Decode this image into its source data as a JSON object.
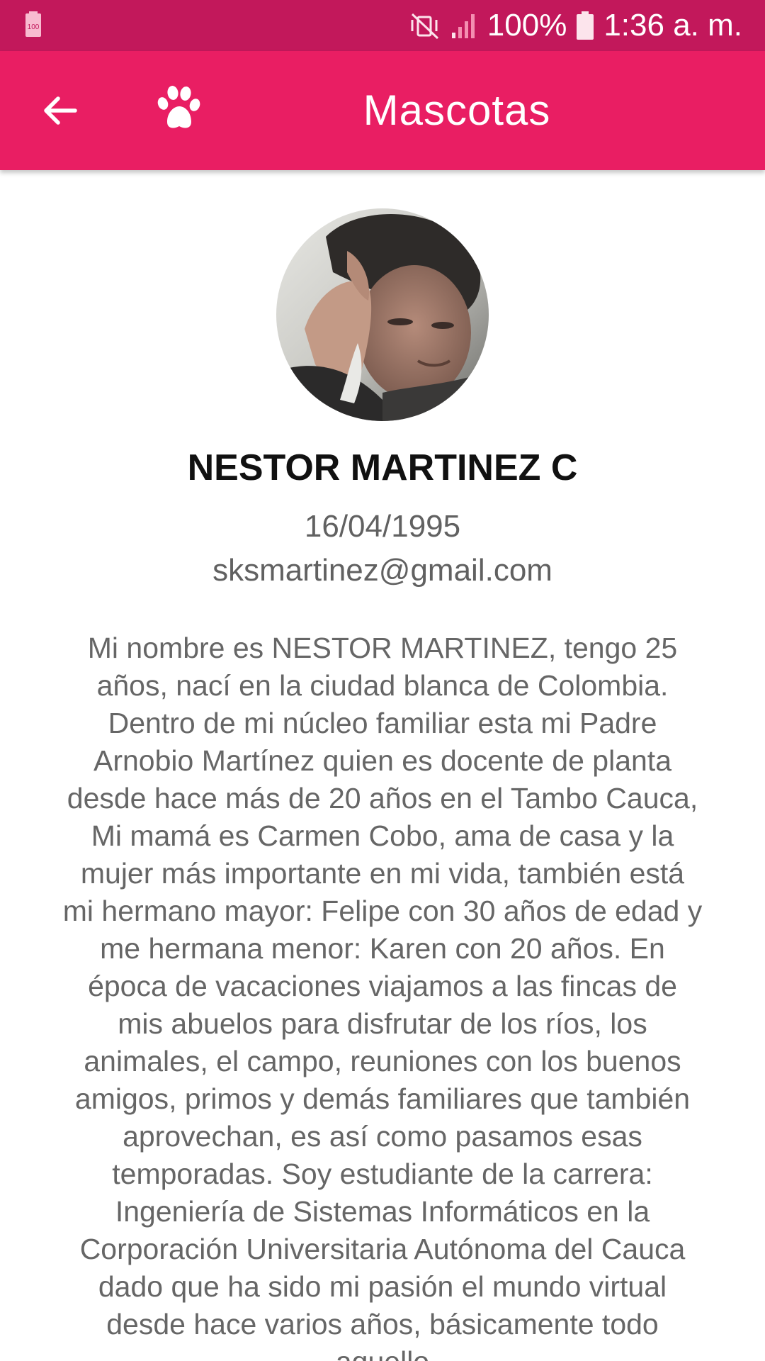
{
  "status_bar": {
    "battery_indicator_icon": "battery-saver-icon",
    "battery_small_label": "100",
    "mute_icon": "vibrate-mute-icon",
    "signal_icon": "signal-icon",
    "battery_percent": "100%",
    "battery_icon": "battery-icon",
    "time": "1:36 a. m."
  },
  "app_bar": {
    "back_icon": "arrow-left-icon",
    "logo_icon": "paw-icon",
    "title": "Mascotas",
    "background_color": "#e91e63",
    "status_color": "#c2185b"
  },
  "profile": {
    "avatar_icon": "profile-photo",
    "name": "NESTOR MARTINEZ C",
    "birth_date": "16/04/1995",
    "email": "sksmartinez@gmail.com",
    "bio": "Mi nombre es NESTOR MARTINEZ, tengo 25 años, nací en la ciudad blanca de Colombia. Dentro de mi núcleo familiar esta mi Padre Arnobio Martínez quien es docente de planta desde hace más de 20 años en el Tambo Cauca, Mi mamá es Carmen Cobo, ama de casa y la mujer más importante en mi vida, también está mi hermano mayor: Felipe con 30 años de edad y me hermana menor: Karen con 20 años. En época de vacaciones viajamos a las fincas de mis abuelos para disfrutar de los ríos, los animales, el campo, reuniones con los buenos amigos, primos y demás familiares que también aprovechan, es así como pasamos esas temporadas. Soy estudiante de la carrera: Ingeniería de Sistemas Informáticos en la Corporación Universitaria Autónoma del Cauca dado que ha sido mi pasión el mundo virtual desde hace varios años, básicamente todo aquello"
  }
}
